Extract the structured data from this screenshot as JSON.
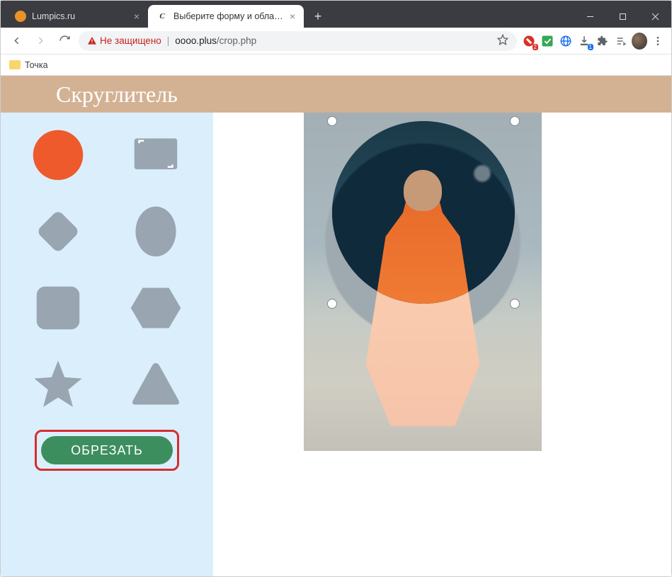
{
  "window": {
    "tabs": [
      {
        "title": "Lumpics.ru",
        "active": false
      },
      {
        "title": "Выберите форму и область для",
        "active": true
      }
    ],
    "address": {
      "not_secure_label": "Не защищено",
      "host": "oooo.plus",
      "path": "/crop.php"
    },
    "bookmarks": [
      {
        "label": "Точка"
      }
    ],
    "ext_badges": {
      "adblock": "2",
      "download": "1"
    }
  },
  "page": {
    "site_title": "Скруглитель",
    "shapes": [
      "circle",
      "rectangle-crop",
      "diamond",
      "ellipse",
      "rounded-square",
      "hexagon",
      "star",
      "triangle"
    ],
    "active_shape": "circle",
    "crop_button_label": "ОБРЕЗАТЬ"
  },
  "colors": {
    "accent": "#e86a2a",
    "inactive_shape": "#9aa5b2",
    "header_bg": "#d3b294",
    "sidebar_bg": "#dbeefc",
    "crop_btn": "#3d8e5e",
    "highlight_border": "#d62e2e"
  }
}
